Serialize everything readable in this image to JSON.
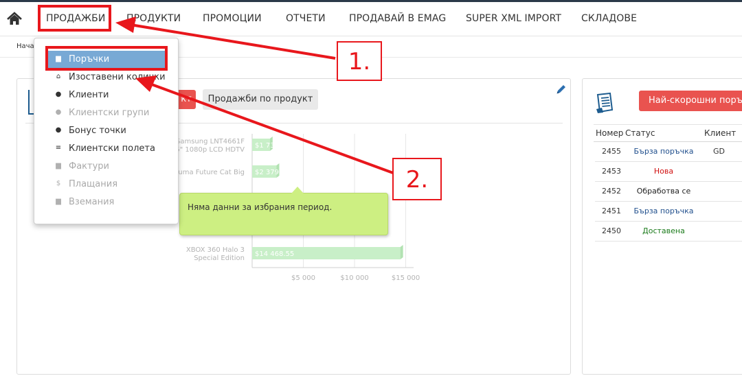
{
  "nav": {
    "items": [
      "ПРОДАЖБИ",
      "ПРОДУКТИ",
      "ПРОМОЦИИ",
      "ОТЧЕТИ",
      "ПРОДАВАЙ В EMAG",
      "SUPER XML IMPORT",
      "СКЛАДОВЕ"
    ]
  },
  "breadcrumb": "Нача",
  "dropdown": {
    "items": [
      {
        "label": "Поръчки",
        "icon": "orders-icon",
        "state": "active"
      },
      {
        "label": "Изоставени колички",
        "icon": "cart-icon",
        "state": "enabled"
      },
      {
        "label": "Клиенти",
        "icon": "user-icon",
        "state": "enabled"
      },
      {
        "label": "Клиентски групи",
        "icon": "users-icon",
        "state": "disabled"
      },
      {
        "label": "Бонус точки",
        "icon": "dot-icon",
        "state": "enabled"
      },
      {
        "label": "Клиентски полета",
        "icon": "list-icon",
        "state": "enabled"
      },
      {
        "label": "Фактури",
        "icon": "invoice-icon",
        "state": "disabled"
      },
      {
        "label": "Плащания",
        "icon": "dollar-icon",
        "state": "disabled"
      },
      {
        "label": "Вземания",
        "icon": "receivable-icon",
        "state": "disabled"
      }
    ]
  },
  "left_panel": {
    "button_red_label": "кт",
    "button_grey_label": "Продажби по продукт",
    "tooltip": "Няма данни за избрания период."
  },
  "chart_data": {
    "type": "bar",
    "orientation": "horizontal",
    "categories": [
      [
        "Samsung LNT4661F",
        "6\" 1080p LCD HDTV"
      ],
      [
        "Puma Future Cat Big"
      ],
      [
        "..."
      ],
      [
        "..."
      ],
      [
        "XBOX 360 Halo 3",
        "Special Edition"
      ]
    ],
    "values": [
      1730.9,
      2379.66,
      null,
      null,
      14468.55
    ],
    "value_labels": [
      "$1 730.9",
      "$2 379.66",
      "",
      "",
      "$14 468.55"
    ],
    "x_ticks": [
      "$5 000",
      "$10 000",
      "$15 000"
    ],
    "xlim": [
      0,
      15500
    ],
    "bar_color": "#c8efc8"
  },
  "right_panel": {
    "button_label": "Най-скорошни поръчки",
    "columns": [
      "Номер",
      "Статус",
      "Клиент"
    ],
    "orders": [
      {
        "number": "2455",
        "status": "Бърза поръчка",
        "status_color": "#1f4e8c",
        "client": "GD"
      },
      {
        "number": "2453",
        "status": "Нова",
        "status_color": "#d01010",
        "client": ""
      },
      {
        "number": "2452",
        "status": "Обработва се",
        "status_color": "#222222",
        "client": ""
      },
      {
        "number": "2451",
        "status": "Бърза поръчка",
        "status_color": "#1f4e8c",
        "client": ""
      },
      {
        "number": "2450",
        "status": "Доставена",
        "status_color": "#1a7a1a",
        "client": ""
      }
    ]
  },
  "annotations": {
    "callouts": [
      "1.",
      "2."
    ],
    "color": "#e8171c"
  }
}
